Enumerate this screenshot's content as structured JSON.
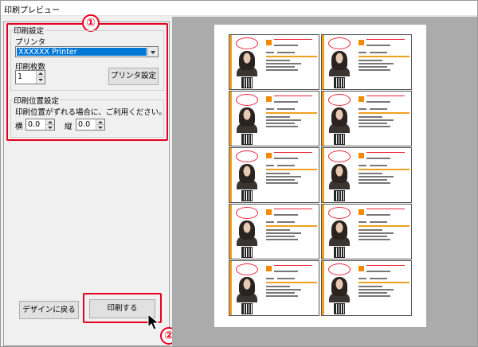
{
  "window": {
    "title": "印刷プレビュー"
  },
  "callouts": {
    "one": "①",
    "two": "②"
  },
  "print_settings": {
    "group_label": "印刷設定",
    "printer_label": "プリンタ",
    "printer_value": "XXXXXX Printer",
    "copies_label": "印刷枚数",
    "copies_value": "1",
    "printer_settings_button": "プリンタ設定"
  },
  "position_settings": {
    "group_label": "印刷位置設定",
    "note": "印刷位置がずれる場合に、ご利用ください。",
    "horizontal_label": "横",
    "horizontal_value": "0.0",
    "vertical_label": "縦",
    "vertical_value": "0.0"
  },
  "actions": {
    "back_label": "デザインに戻る",
    "print_label": "印刷する"
  },
  "preview": {
    "card_count": 10,
    "accent": "#f0a020",
    "highlight": "#e6001f"
  }
}
